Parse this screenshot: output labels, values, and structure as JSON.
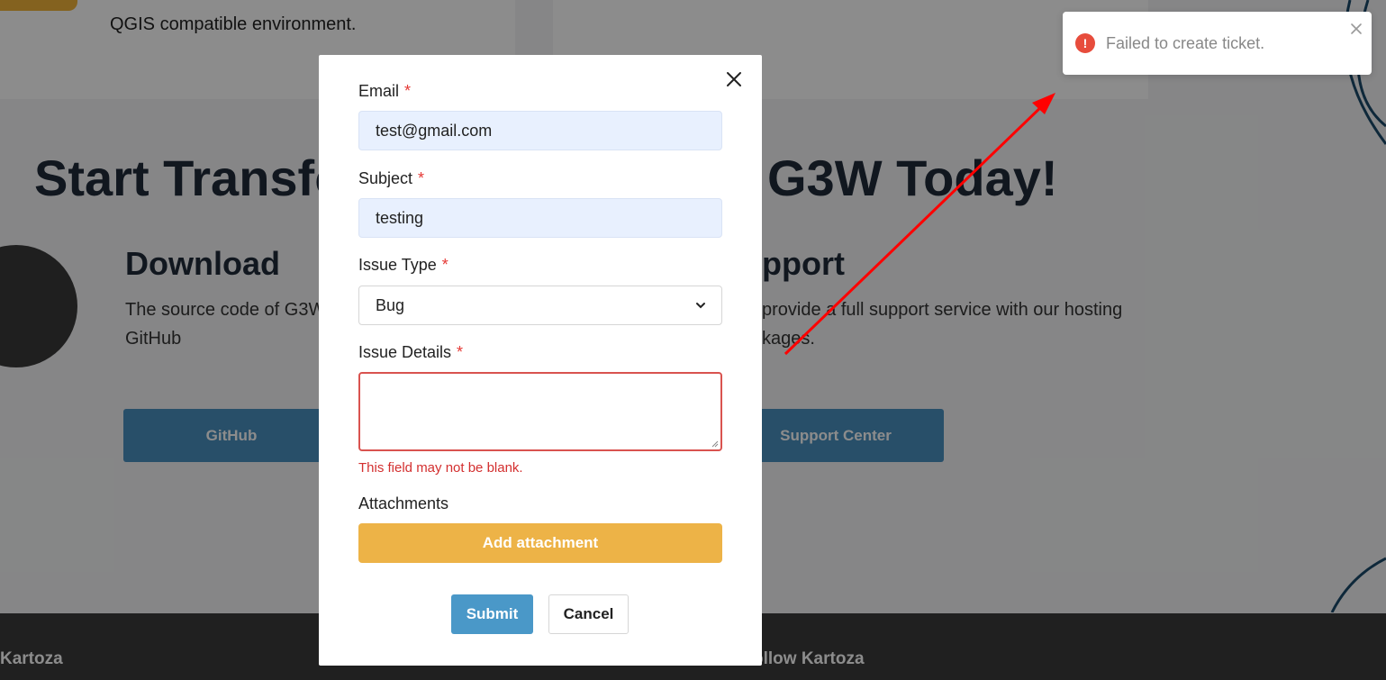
{
  "background": {
    "top_card_text": "QGIS compatible environment.",
    "heading_left": "Start Transfor",
    "heading_right": "G3W Today!",
    "download": {
      "title": "Download",
      "text_line1": "The source code of G3W",
      "text_line2": "GitHub",
      "button": "GitHub"
    },
    "support": {
      "title": "pport",
      "text_line1": "provide a full support service with our hosting",
      "text_line2": "kages.",
      "button": "Support Center"
    },
    "footer": {
      "left": "Kartoza",
      "right": "ollow Kartoza"
    }
  },
  "modal": {
    "email": {
      "label": "Email",
      "required": "*",
      "value": "test@gmail.com"
    },
    "subject": {
      "label": "Subject",
      "required": "*",
      "value": "testing"
    },
    "issue_type": {
      "label": "Issue Type",
      "required": "*",
      "value": "Bug"
    },
    "issue_details": {
      "label": "Issue Details",
      "required": "*",
      "value": "",
      "error": "This field may not be blank."
    },
    "attachments": {
      "label": "Attachments",
      "button": "Add attachment"
    },
    "submit": "Submit",
    "cancel": "Cancel"
  },
  "toast": {
    "icon": "!",
    "message": "Failed to create ticket."
  },
  "colors": {
    "error": "#e74c3c",
    "accent": "#edb347",
    "primary": "#4a98c8"
  }
}
